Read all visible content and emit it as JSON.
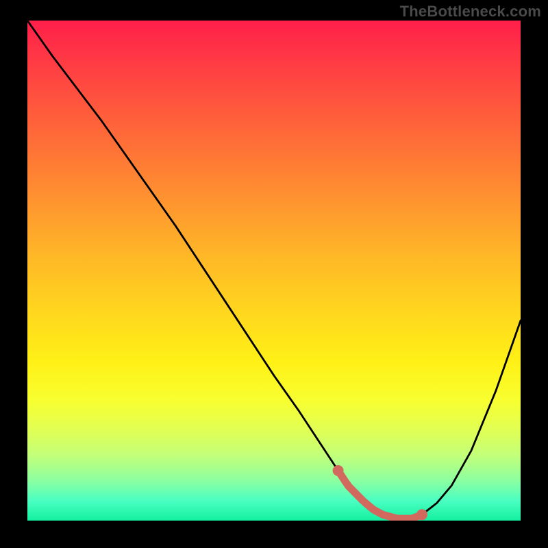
{
  "watermark": "TheBottleneck.com",
  "colors": {
    "marker": "#d1695f",
    "curve": "#000000"
  },
  "chart_data": {
    "type": "line",
    "title": "",
    "xlabel": "",
    "ylabel": "",
    "xlim": [
      0,
      100
    ],
    "ylim": [
      0,
      100
    ],
    "grid": false,
    "legend": false,
    "series": [
      {
        "name": "bottleneck-curve",
        "x": [
          0,
          5,
          10,
          15,
          20,
          25,
          30,
          35,
          40,
          45,
          50,
          55,
          60,
          63,
          65,
          68,
          70,
          72,
          75,
          78,
          80,
          83,
          86,
          90,
          95,
          100
        ],
        "values": [
          100,
          93,
          86.5,
          80,
          73,
          66,
          59,
          51.5,
          44,
          36.5,
          29,
          22,
          14.5,
          10,
          7,
          4,
          2.3,
          1.2,
          0.4,
          0.4,
          1.2,
          3.5,
          7,
          14,
          26,
          40
        ]
      }
    ],
    "optimal_range": {
      "x_start": 63,
      "x_end": 80,
      "y_start": 10,
      "y_end": 1.2
    }
  }
}
